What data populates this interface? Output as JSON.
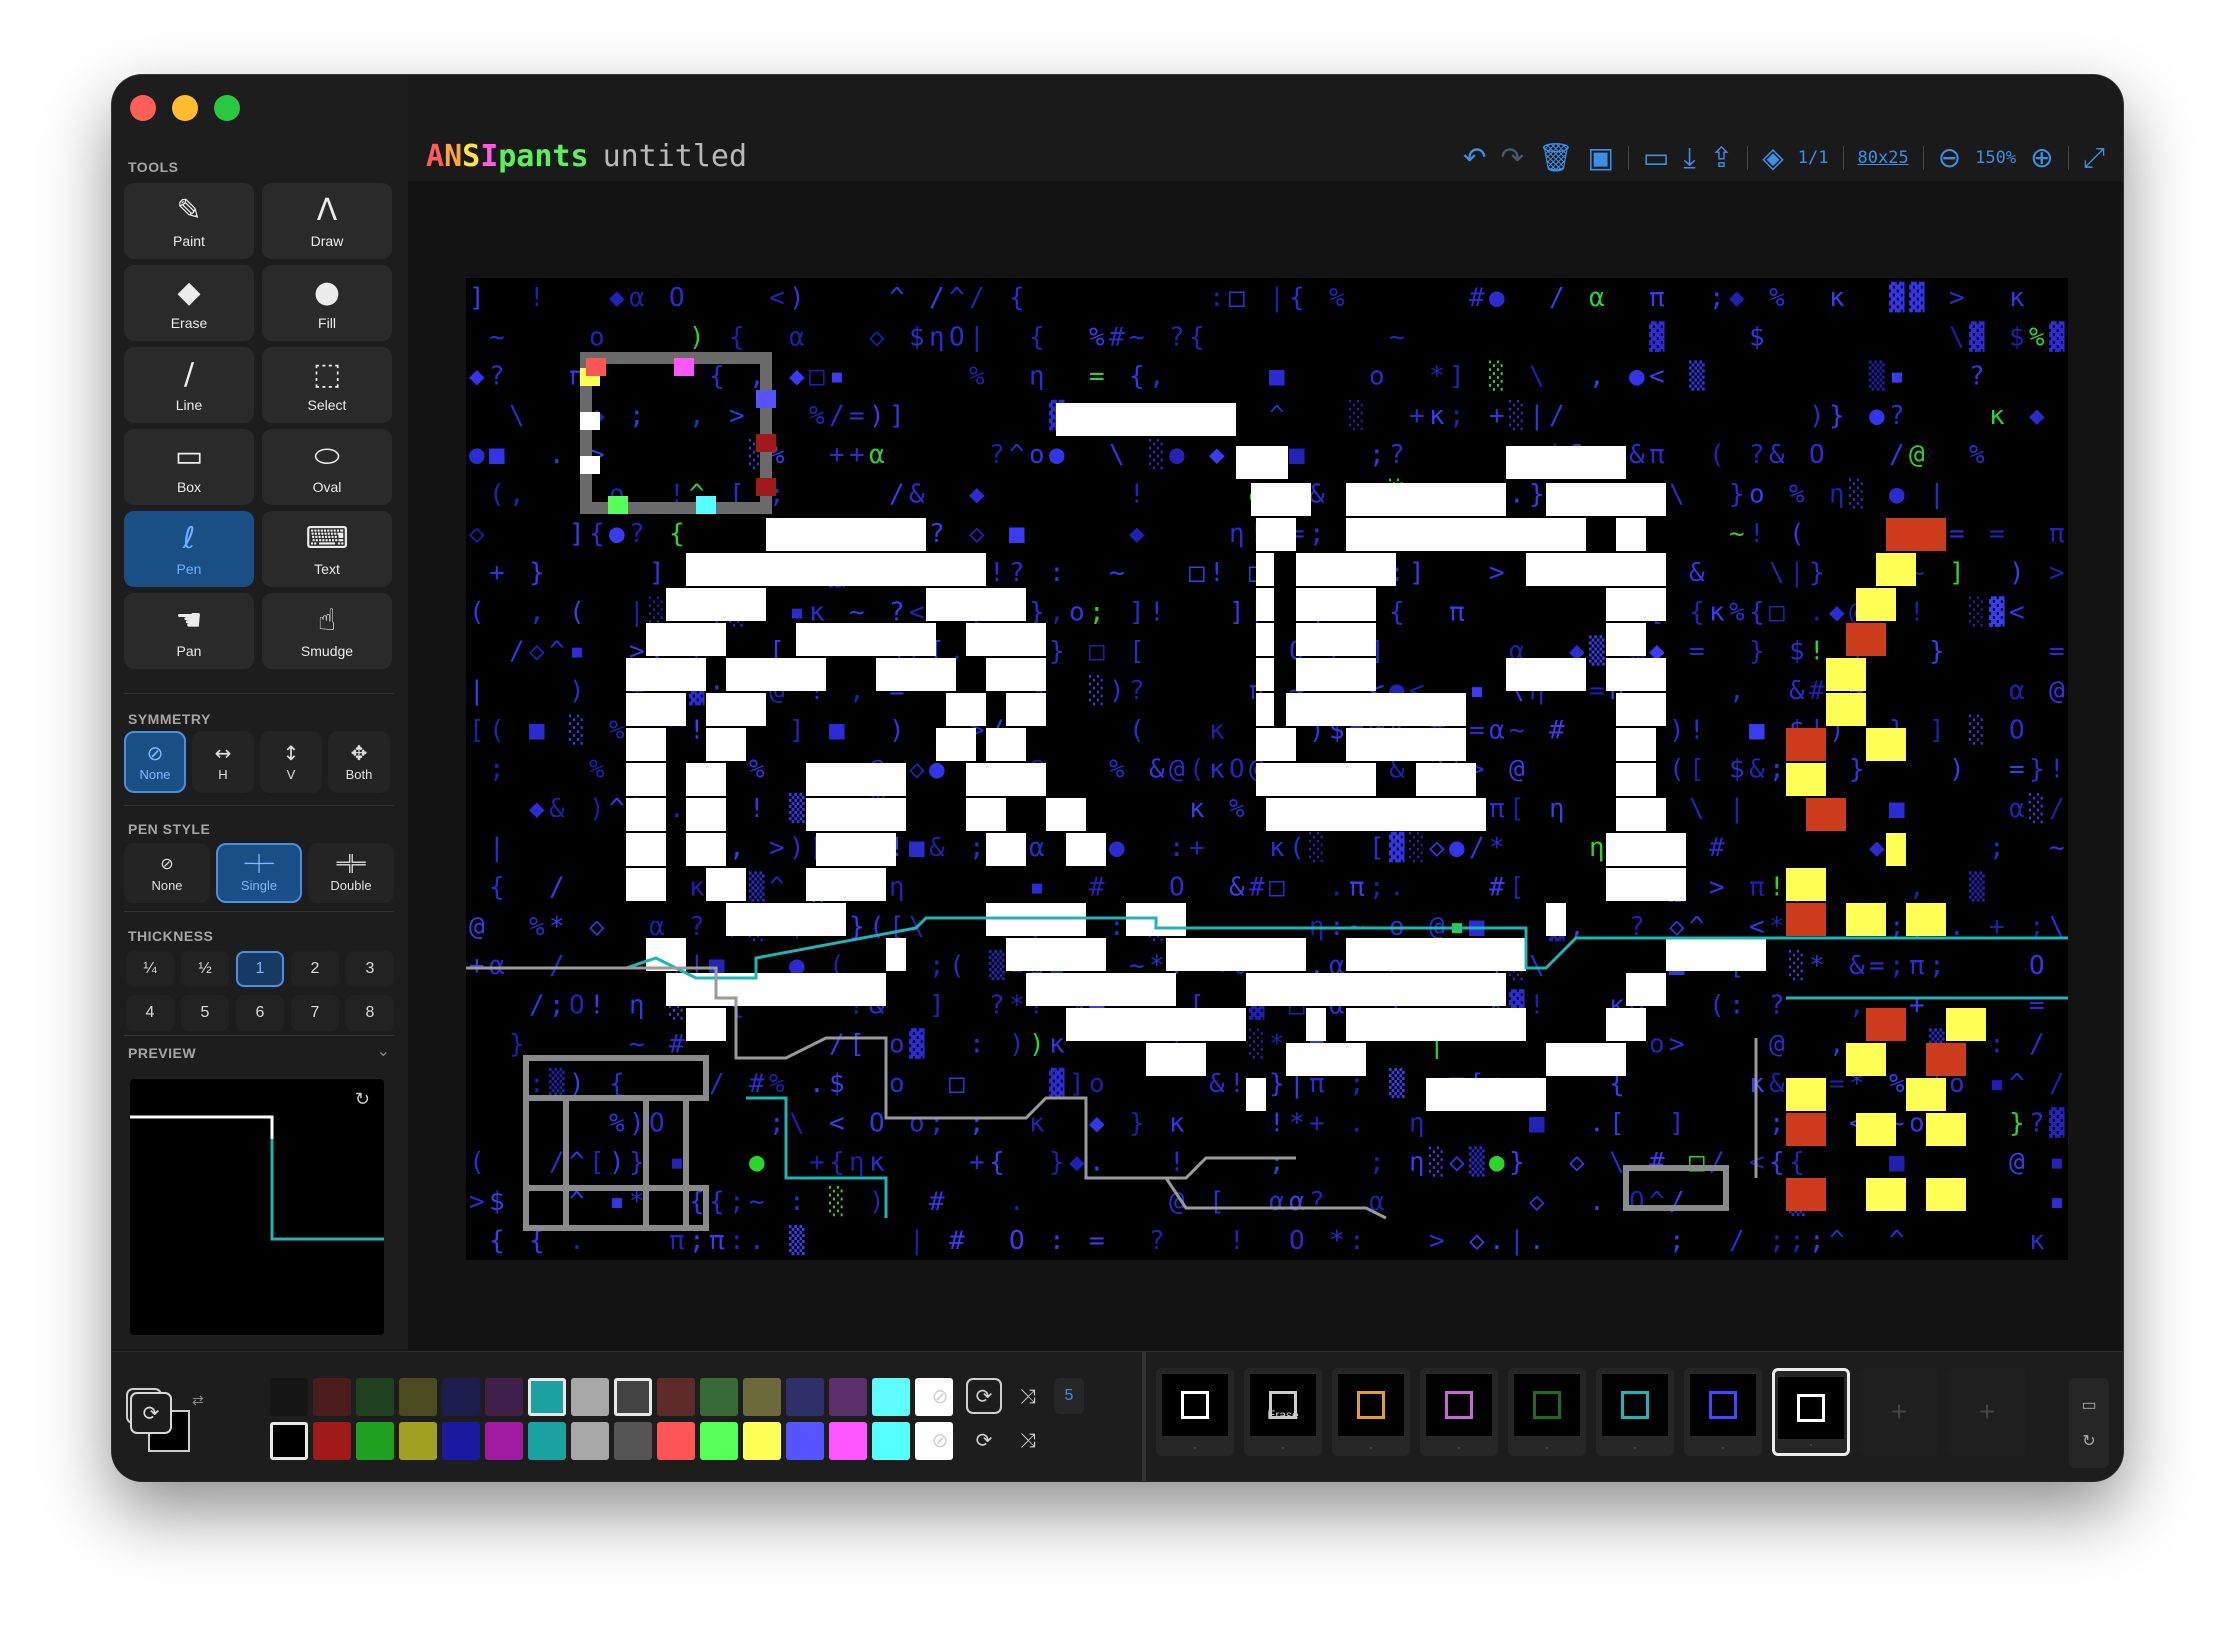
{
  "app": {
    "brand_letters": [
      {
        "ch": "A",
        "color": "#ff5d5d"
      },
      {
        "ch": "N",
        "color": "#ffa53b"
      },
      {
        "ch": "S",
        "color": "#ffe14a"
      },
      {
        "ch": "I",
        "color": "#ff5ce2"
      },
      {
        "ch": "pants",
        "color": "#5af25a"
      }
    ],
    "document_name": "untitled"
  },
  "toolbar": {
    "layers_count": "1/1",
    "canvas_size": "80x25",
    "zoom_level": "150%"
  },
  "sidebar": {
    "tools_label": "TOOLS",
    "tools": [
      {
        "label": "Paint",
        "icon": "brush-icon",
        "glyph": "✎",
        "active": false
      },
      {
        "label": "Draw",
        "icon": "compass-icon",
        "glyph": "Ʌ",
        "active": false
      },
      {
        "label": "Erase",
        "icon": "eraser-icon",
        "glyph": "◆",
        "active": false
      },
      {
        "label": "Fill",
        "icon": "drop-icon",
        "glyph": "●",
        "active": false
      },
      {
        "label": "Line",
        "icon": "line-icon",
        "glyph": "∕",
        "active": false
      },
      {
        "label": "Select",
        "icon": "select-icon",
        "glyph": "⬚",
        "active": false
      },
      {
        "label": "Box",
        "icon": "box-icon",
        "glyph": "▭",
        "active": false
      },
      {
        "label": "Oval",
        "icon": "oval-icon",
        "glyph": "⬭",
        "active": false
      },
      {
        "label": "Pen",
        "icon": "scribble-icon",
        "glyph": "ℓ",
        "active": true
      },
      {
        "label": "Text",
        "icon": "keyboard-icon",
        "glyph": "⌨",
        "active": false
      },
      {
        "label": "Pan",
        "icon": "hand-icon",
        "glyph": "☚",
        "active": false
      },
      {
        "label": "Smudge",
        "icon": "pointer-hand-icon",
        "glyph": "☝",
        "active": false
      }
    ],
    "symmetry_label": "SYMMETRY",
    "symmetry": [
      {
        "label": "None",
        "glyph": "⊘",
        "icon": "none-icon",
        "active": true
      },
      {
        "label": "H",
        "glyph": "↔",
        "icon": "horizontal-arrows-icon",
        "active": false
      },
      {
        "label": "V",
        "glyph": "↕",
        "icon": "vertical-arrows-icon",
        "active": false
      },
      {
        "label": "Both",
        "glyph": "✥",
        "icon": "four-arrows-icon",
        "active": false
      }
    ],
    "pen_style_label": "PEN STYLE",
    "pen_styles": [
      {
        "label": "None",
        "glyph": "⊘",
        "icon": "none-icon",
        "active": false
      },
      {
        "label": "Single",
        "glyph": "─┼─",
        "icon": "single-line-icon",
        "active": true
      },
      {
        "label": "Double",
        "glyph": "═╬═",
        "icon": "double-line-icon",
        "active": false
      }
    ],
    "thickness_label": "THICKNESS",
    "thickness": [
      "¼",
      "½",
      "1",
      "2",
      "3",
      "4",
      "5",
      "6",
      "7",
      "8"
    ],
    "thickness_selected": "1",
    "preview_label": "PREVIEW"
  },
  "palette": {
    "dark_row": [
      "#151515",
      "#4a1c1c",
      "#1f4120",
      "#4b4b21",
      "#1c1c4d",
      "#40204b",
      "#1ba1a1",
      "#a8a8a8",
      "#444444",
      "#5e2a2a",
      "#376a37",
      "#6a6a3a",
      "#2f2f6a",
      "#5a2f6a",
      "#5efcfc",
      "#ffffff"
    ],
    "bright_row": [
      "#000000",
      "#a11a1a",
      "#21a121",
      "#a1a121",
      "#1a1aa1",
      "#a11aa1",
      "#1aa1a1",
      "#a8a8a8",
      "#555555",
      "#ff5555",
      "#55ff55",
      "#ffff55",
      "#5555ff",
      "#ff55ff",
      "#55ffff",
      "#ffffff"
    ],
    "foreground": "#000000",
    "background": "#000000",
    "random_count": "5"
  },
  "frames": [
    {
      "label": "",
      "icon": "brush-icon"
    },
    {
      "label": "Erase",
      "icon": "eraser-icon"
    },
    {
      "label": "",
      "icon": "compass-icon"
    },
    {
      "label": "",
      "icon": "oval-icon"
    },
    {
      "label": "",
      "icon": "line-icon"
    },
    {
      "label": "",
      "icon": "box-icon"
    },
    {
      "label": "",
      "icon": "drop-icon"
    },
    {
      "label": "",
      "icon": "scribble-icon"
    }
  ]
}
